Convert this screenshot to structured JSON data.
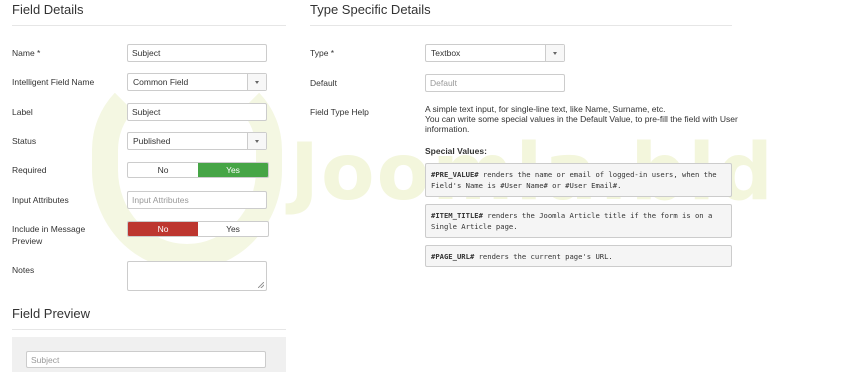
{
  "colors": {
    "yes_green": "#46a546",
    "no_red": "#bd362f",
    "watermark": "#f3f6dc"
  },
  "watermark_text": "Joomla.bld",
  "field_details": {
    "heading": "Field Details",
    "name": {
      "label": "Name *",
      "value": "Subject"
    },
    "intelligent": {
      "label": "Intelligent Field Name",
      "value": "Common Field"
    },
    "label_field": {
      "label": "Label",
      "value": "Subject"
    },
    "status": {
      "label": "Status",
      "value": "Published"
    },
    "required": {
      "label": "Required",
      "no": "No",
      "yes": "Yes",
      "selected": "Yes"
    },
    "input_attributes": {
      "label": "Input Attributes",
      "placeholder": "Input Attributes"
    },
    "include_preview": {
      "label_line1": "Include in Message",
      "label_line2": "Preview",
      "no": "No",
      "yes": "Yes",
      "selected": "No"
    },
    "notes": {
      "label": "Notes"
    }
  },
  "field_preview": {
    "heading": "Field Preview",
    "placeholder": "Subject"
  },
  "type_specific": {
    "heading": "Type Specific Details",
    "type": {
      "label": "Type *",
      "value": "Textbox"
    },
    "default": {
      "label": "Default",
      "placeholder": "Default"
    },
    "help": {
      "label": "Field Type Help",
      "line1": "A simple text input, for single-line text, like Name, Surname, etc.",
      "line2": "You can write some special values in the Default Value, to pre-fill the field with User",
      "line3": "information."
    },
    "special_values_title": "Special Values:",
    "codes": [
      {
        "tag": "#PRE_VALUE#",
        "text1": " renders the name or email of logged-in users, when the",
        "text2a": "Field's Name is ",
        "tag2": "#User Name#",
        "text2b": " or ",
        "tag3": "#User Email#",
        "text2c": "."
      },
      {
        "tag": "#ITEM_TITLE#",
        "text1": " renders the Joomla Article title if the form is on a",
        "text2": "Single Article page."
      },
      {
        "tag": "#PAGE_URL#",
        "text1": " renders the current page's URL."
      }
    ]
  }
}
